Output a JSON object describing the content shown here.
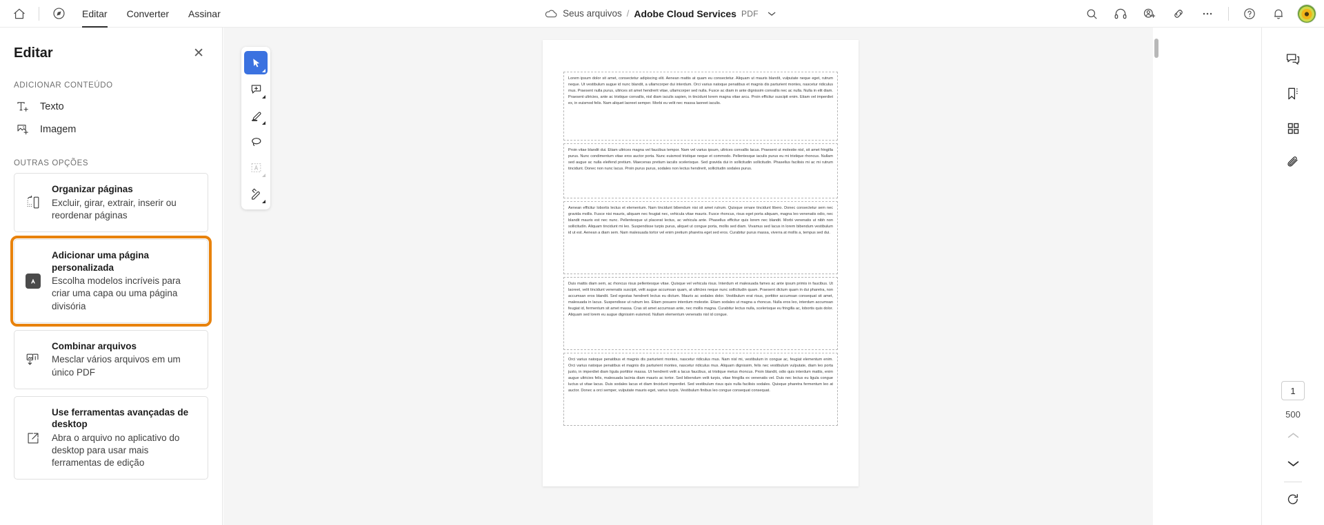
{
  "topbar": {
    "home_icon": "home-icon",
    "compass_icon": "compass-icon",
    "tabs": [
      {
        "label": "Editar",
        "active": true
      },
      {
        "label": "Converter",
        "active": false
      },
      {
        "label": "Assinar",
        "active": false
      }
    ],
    "breadcrumb": {
      "cloud_icon": "cloud-icon",
      "root": "Seus arquivos",
      "separator": "/",
      "current": "Adobe Cloud Services",
      "filetype": "PDF",
      "chevron_icon": "chevron-down-icon"
    },
    "right_icons": [
      "search-icon",
      "headphones-icon",
      "add-person-icon",
      "link-icon",
      "more-options-icon",
      "help-icon",
      "bell-icon"
    ],
    "avatar": "user-avatar"
  },
  "leftpanel": {
    "title": "Editar",
    "close_label": "✕",
    "section_add": "ADICIONAR CONTEÚDO",
    "add_items": [
      {
        "label": "Texto",
        "icon": "add-text-icon"
      },
      {
        "label": "Imagem",
        "icon": "add-image-icon"
      }
    ],
    "section_other": "OUTRAS OPÇÕES",
    "cards": [
      {
        "icon": "organize-pages-icon",
        "title": "Organizar páginas",
        "desc": "Excluir, girar, extrair, inserir ou reordenar páginas",
        "selected": false
      },
      {
        "icon": "adobe-express-icon",
        "title": "Adicionar uma página personalizada",
        "desc": "Escolha modelos incríveis para criar uma capa ou uma página divisória",
        "selected": true
      },
      {
        "icon": "combine-files-icon",
        "title": "Combinar arquivos",
        "desc": "Mesclar vários arquivos em um único PDF",
        "selected": false
      },
      {
        "icon": "open-desktop-icon",
        "title": "Use ferramentas avançadas de desktop",
        "desc": "Abra o arquivo no aplicativo do desktop para usar mais ferramentas de edição",
        "selected": false
      }
    ]
  },
  "toolrail": {
    "tools": [
      {
        "name": "select-tool",
        "active": true,
        "disabled": false,
        "caret": true
      },
      {
        "name": "add-comment-tool",
        "active": false,
        "disabled": false,
        "caret": true
      },
      {
        "name": "highlight-tool",
        "active": false,
        "disabled": false,
        "caret": true
      },
      {
        "name": "lasso-tool",
        "active": false,
        "disabled": false,
        "caret": false
      },
      {
        "name": "text-select-tool",
        "active": false,
        "disabled": true,
        "caret": true
      },
      {
        "name": "sign-tool",
        "active": false,
        "disabled": false,
        "caret": true
      }
    ]
  },
  "document": {
    "paragraphs": [
      "Lorem ipsum dolor sit amet, consectetur adipiscing elit. Aenean mattis at quam eu consectetur. Aliquam ut mauris blandit, vulputate neque eget, rutrum neque. Ut vestibulum augue id nunc blandit, a ullamcorper dui interdum. Orci varius natoque penatibus et magnis dis parturient montes, nascetur ridiculus mus. Praesent nulla purus, ultrices sit amet hendrerit vitae, ullamcorper sed nulla. Fusce ac diam in ante dignissim convallis nec ac nulla. Nulla in elit diam. Praesent ultricies, ante ac tristique convallis, nisl diam iaculis sapien, in tincidunt lorem magna vitae arcu. Proin efficitur suscipit enim. Etiam vel imperdiet ex, in euismod felis. Nam aliquet laoreet semper. Morbi eu velit nec massa laoreet iaculis.",
      "Proin vitae blandit dui. Etiam ultrices magna vel faucibus tempor. Nam vel varius ipsum, ultrices convallis lacus. Praesent ut molestie nisl, sit amet fringilla purus. Nunc condimentum vitae eros auctor porta. Nunc euismod tristique neque et commodo. Pellentesque iaculis purus eu mi tristique rhoncus. Nullam sed augue ac nulla eleifend pretium. Maecenas pretium iaculis scelerisque. Sed gravida dui in sollicitudin sollicitudin. Phasellus facilisis mi ac mi rutrum tincidunt. Donec non nunc lacus. Proin purus purus, sodales non lectus hendrerit, sollicitudin sodales purus.",
      "Aenean efficitur lobortis lectus et elementum. Nam tincidunt bibendum nisi sit amet rutrum. Quisque ornare tincidunt libero. Donec consectetur sem nec gravida mollis. Fusce nisi mauris, aliquam nec feugiat nec, vehicula vitae mauris. Fusce rhoncus, risus eget porta aliquam, magna leo venenatis odio, nec blandit mauris est nec nunc. Pellentesque ut placerat lectus, ac vehicula ante. Phasellus efficitur quis lorem nec blandit. Morbi venenatis ut nibh non sollicitudin. Aliquam tincidunt mi leo. Suspendisse turpis purus, aliquet ut congue porta, mollis sed diam. Vivamus sed lacus in lorem bibendum vestibulum id ut est. Aenean a diam sem. Nam malesuada tortor vel enim pretium pharetra eget sed eros. Curabitur purus massa, viverra at mollis a, tempus sed dui.",
      "Duis mattis diam sem, ac rhoncus risus pellentesque vitae. Quisque vel vehicula risus. Interdum et malesuada fames ac ante ipsum primis in faucibus. Ut laoreet, velit tincidunt venenatis suscipit, velit augue accumsan quam, at ultricies neque nunc sollicitudin quam. Praesent dictum quam in dui pharetra, non accumsan eros blandit. Sed egestas hendrerit lectus eu dictum. Mauris ac sodales dolor. Vestibulum erat risus, porttitor accumsan consequat sit amet, malesuada in lacus. Suspendisse ut rutrum leo. Etiam posuere interdum molestie. Etiam sodales ut magna a rhoncus. Nulla eros leo, interdum accumsan feugiat id, fermentum sit amet massa. Cras sit amet accumsan ante, nec mollis magna. Curabitur lectus nulla, scelerisque eu fringilla ac, lobortis quis dolor. Aliquam sed lorem eu augue dignissim euismod. Nullam elementum venenatis nisl id congue.",
      "Orci varius natoque penatibus et magnis dis parturient montes, nascetur ridiculus mus. Nam nisl mi, vestibulum in congue ac, feugiat elementum enim. Orci varius natoque penatibus et magnis dis parturient montes, nascetur ridiculus mus. Aliquam dignissim, felis nec vestibulum vulputate, diam leo porta justo, in imperdiet diam ligula porttitor massa. Ut hendrerit velit a lacus faucibus, at tristique metus rhoncus. Proin blandit, odio quis interdum mattis, enim augue ultricies felis, malesuada lacinia diam mauris ac tortor. Sed bibendum velit turpis, vitae fringilla ex venenatis vel. Duis nec lectus eu ligula congue luctus ut vitae lacus. Duis sodales lacus et diam tincidunt imperdiet. Sed vestibulum risus quis nulla facilisis sodales. Quisque pharetra fermentum leo at auctor. Donec a orci semper, vulputate mauris eget, varius turpis. Vestibulum finibus leo congue consequat consequat."
    ]
  },
  "rightrail": {
    "icons": [
      "comments-icon",
      "bookmarks-icon",
      "page-thumbnails-icon",
      "attachments-icon"
    ],
    "current_page": "1",
    "total_pages": "500",
    "prev_icon": "chevron-up-icon",
    "next_icon": "chevron-down-icon",
    "rotate_icon": "rotate-icon"
  },
  "colors": {
    "accent_selected": "#e8820c",
    "tool_active": "#3b72e0",
    "viewer_bg": "#f5f5f5"
  }
}
